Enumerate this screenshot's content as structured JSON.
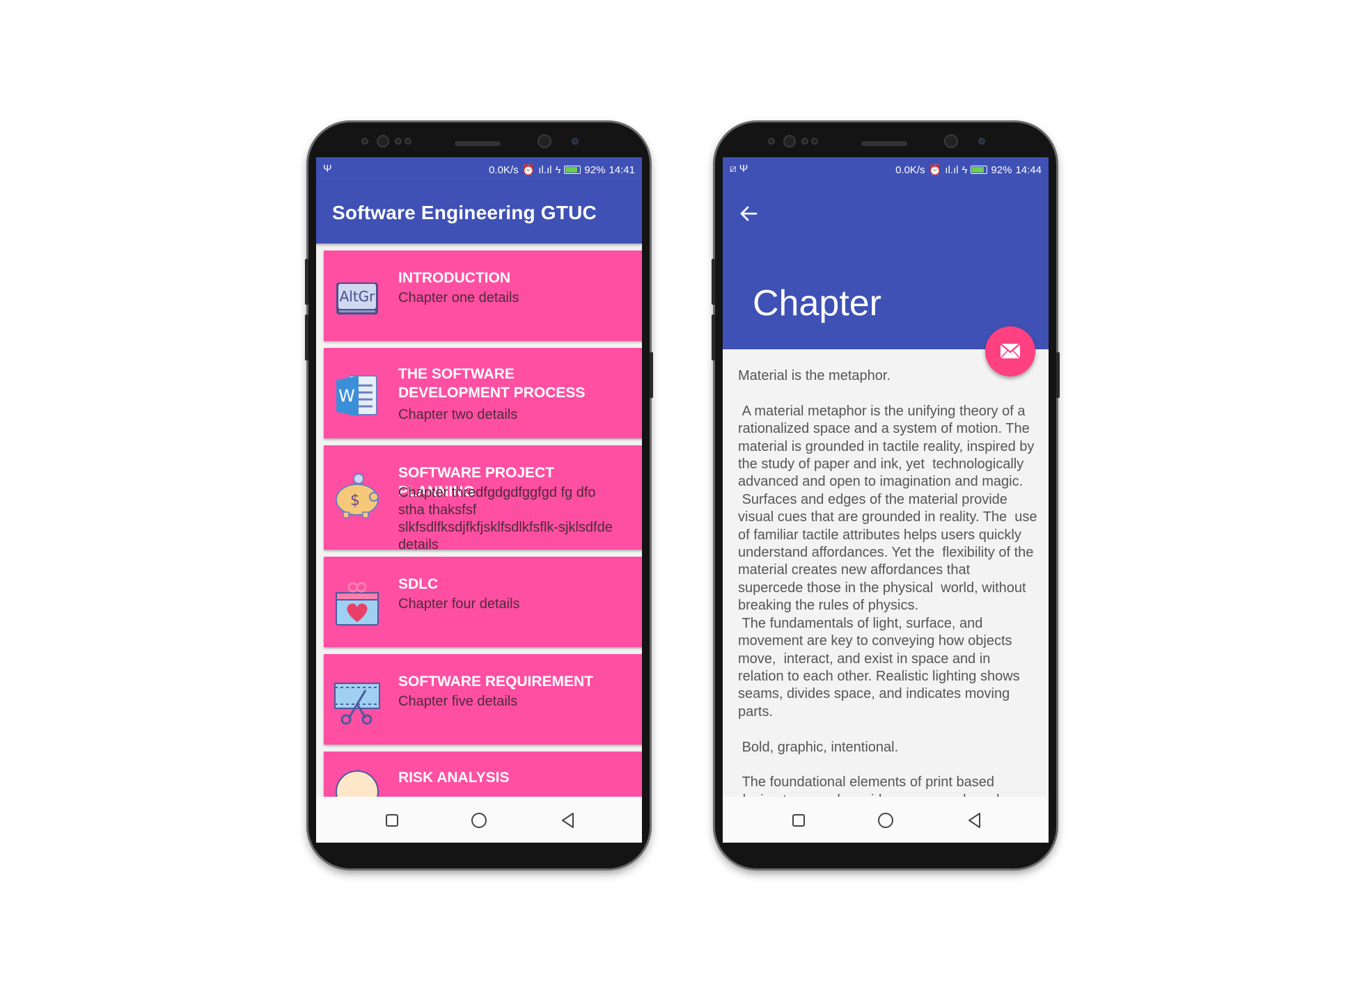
{
  "left_phone": {
    "status": {
      "left_icon": "usb-icon",
      "speed": "0.0K/s",
      "battery": "92%",
      "time": "14:41",
      "battery_level": 0.92
    },
    "app_title": "Software Engineering GTUC",
    "cards": [
      {
        "title": "INTRODUCTION",
        "subtitle": "Chapter one details",
        "icon": "altgr-key-icon"
      },
      {
        "title": "THE SOFTWARE DEVELOPMENT PROCESS",
        "subtitle": "Chapter two details",
        "icon": "word-document-icon"
      },
      {
        "title": "SOFTWARE PROJECT PLANNING",
        "subtitle": "Chapter thredfgdgdfggfgd fg dfo stha thaksfsf slkfsdlfksdjfkfjsklfsdlkfsflk-sjklsdfde details",
        "icon": "piggy-bank-icon"
      },
      {
        "title": "SDLC",
        "subtitle": "Chapter four details",
        "icon": "gift-heart-icon"
      },
      {
        "title": "SOFTWARE REQUIREMENT",
        "subtitle": "Chapter five details",
        "icon": "film-scissors-icon"
      },
      {
        "title": "RISK ANALYSIS",
        "subtitle": "",
        "icon": "risk-icon"
      }
    ]
  },
  "right_phone": {
    "status": {
      "left_icon": "usb-icon",
      "speed": "0.0K/s",
      "battery": "92%",
      "time": "14:44",
      "battery_level": 0.92
    },
    "title": "Chapter",
    "body": "Material is the metaphor.\n\n A material metaphor is the unifying theory of a rationalized space and a system of motion. The material is grounded in tactile reality, inspired by the study of paper and ink, yet  technologically advanced and open to imagination and magic.\n Surfaces and edges of the material provide visual cues that are grounded in reality. The  use of familiar tactile attributes helps users quickly understand affordances. Yet the  flexibility of the material creates new affordances that supercede those in the physical  world, without breaking the rules of physics.\n The fundamentals of light, surface, and movement are key to conveying how objects move,  interact, and exist in space and in relation to each other. Realistic lighting shows  seams, divides space, and indicates moving parts.\n\n Bold, graphic, intentional.\n\n The foundational elements of print based design typography, grids, space, scale, color,  and use of imagery guide visual treatments. These elements do"
  },
  "colors": {
    "primary": "#3f51b5",
    "card": "#ff4fa2",
    "accent": "#ff4081",
    "background": "#f3f3f3"
  }
}
